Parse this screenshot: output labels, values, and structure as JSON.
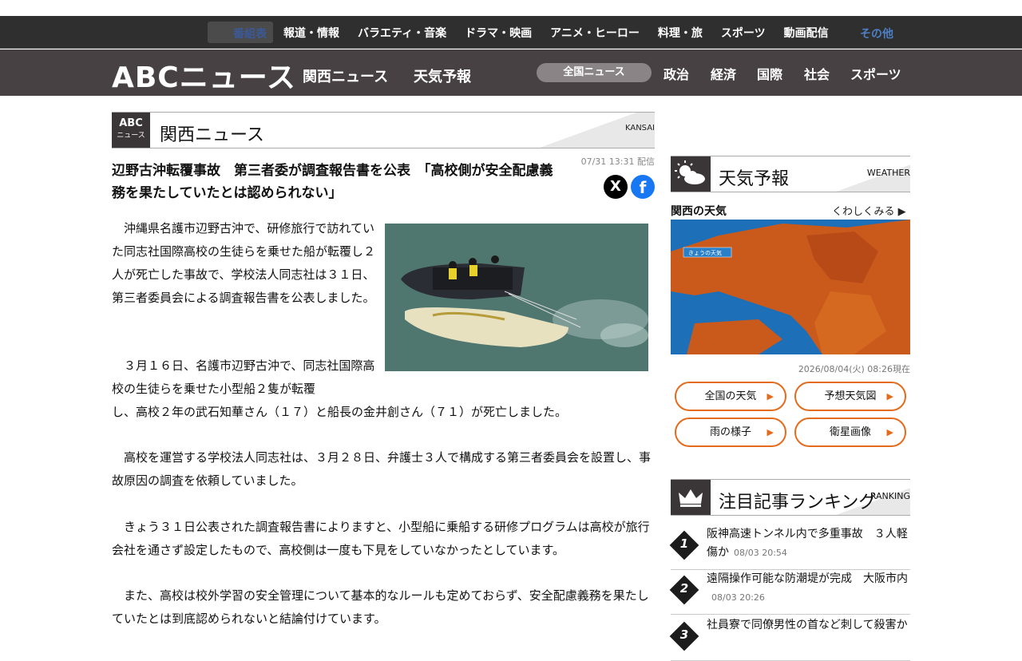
{
  "topnav": {
    "program_tab": "番組表",
    "items": [
      "報道・情報",
      "バラエティ・音楽",
      "ドラマ・映画",
      "アニメ・ヒーロー",
      "料理・旅",
      "スポーツ",
      "動画配信"
    ],
    "other": "その他"
  },
  "header": {
    "logo": "ABCニュース",
    "kansai_news": "関西ニュース",
    "weather": "天気予報",
    "zenkoku": "全国ニュース",
    "categories": [
      "政治",
      "経済",
      "国際",
      "社会",
      "スポーツ"
    ]
  },
  "section": {
    "badge_top": "ABC",
    "badge_bottom": "ニュース",
    "title": "関西ニュース",
    "en": "KANSAI"
  },
  "article": {
    "date": "07/31 13:31 配信",
    "headline": "辺野古沖転覆事故　第三者委が調査報告書を公表　「高校側が安全配慮義務を果たしていたとは認められない」",
    "share_x": "X",
    "share_fb": "f",
    "p1": "　沖縄県名護市辺野古沖で、研修旅行で訪れていた同志社国際高校の生徒らを乗せた船が転覆し２人が死亡した事故で、学校法人同志社は３１日、第三者委員会による調査報告書を公表しました。",
    "p2a": "　３月１６日、名護市辺野古沖で、同志社国際高校の生徒らを乗せた小型船２隻が転覆",
    "p2b": "し、高校２年の武石知華さん（１７）と船長の金井創さん（７１）が死亡しました。",
    "p3": "　高校を運営する学校法人同志社は、３月２８日、弁護士３人で構成する第三者委員会を設置し、事故原因の調査を依頼していました。",
    "p4": "　きょう３１日公表された調査報告書によりますと、小型船に乗船する研修プログラムは高校が旅行会社を通さず設定したもので、高校側は一度も下見をしていなかったとしています。",
    "p5": "　また、高校は校外学習の安全管理について基本的なルールも定めておらず、安全配慮義務を果たしていたとは到底認められないと結論付けています。"
  },
  "weather": {
    "title": "天気予報",
    "en": "WEATHER",
    "label": "関西の天気",
    "more": "くわしくみる",
    "map_caption": "きょうの天気",
    "time": "2026/08/04(火) 08:26現在",
    "buttons": [
      "全国の天気",
      "予想天気図",
      "雨の様子",
      "衛星画像"
    ]
  },
  "ranking": {
    "title": "注目記事ランキング",
    "en": "RANKING",
    "items": [
      {
        "rank": "1",
        "title": "阪神高速トンネル内で多重事故　３人軽傷か",
        "date": "08/03 20:54"
      },
      {
        "rank": "2",
        "title": "遠隔操作可能な防潮堤が完成　大阪市内",
        "date": "08/03 20:26"
      },
      {
        "rank": "3",
        "title": "社員寮で同僚男性の首など刺して殺害か",
        "date": ""
      }
    ]
  },
  "colors": {
    "accent": "#e46b1c",
    "header_bg": "#474143",
    "topbar_bg": "#2f2f2f"
  }
}
